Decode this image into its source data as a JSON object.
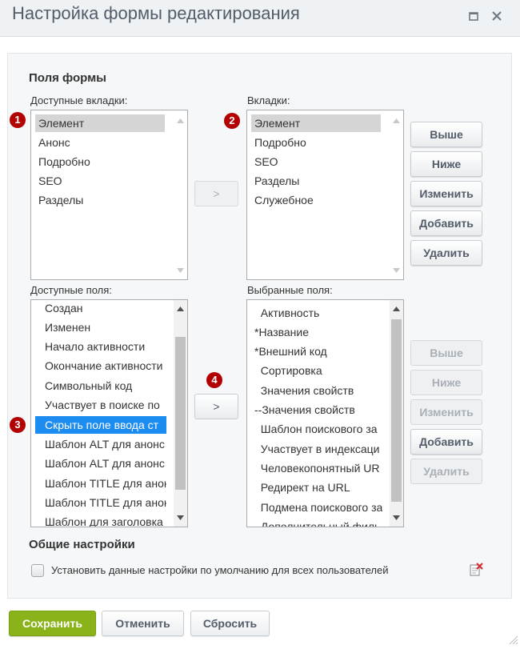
{
  "window": {
    "title": "Настройка формы редактирования"
  },
  "form_fields": {
    "section_title": "Поля формы",
    "available_tabs": {
      "label": "Доступные вкладки:",
      "items": [
        "Элемент",
        "Анонс",
        "Подробно",
        "SEO",
        "Разделы"
      ],
      "selected": "Элемент"
    },
    "tabs": {
      "label": "Вкладки:",
      "items": [
        "Элемент",
        "Подробно",
        "SEO",
        "Разделы",
        "Служебное"
      ],
      "selected": "Элемент"
    },
    "available_fields": {
      "label": "Доступные поля:",
      "items": [
        "Создан",
        "Изменен",
        "Начало активности",
        "Окончание активности",
        "Символьный код",
        "Участвует в поиске по",
        "Скрыть поле ввода ст",
        "Шаблон ALT для анонс",
        "Шаблон ALT для анонс",
        "Шаблон TITLE для анон",
        "Шаблон TITLE для анон",
        "Шаблон для заголовка"
      ],
      "selected": "Скрыть поле ввода ст"
    },
    "selected_fields": {
      "label": "Выбранные поля:",
      "items": [
        "  Активность",
        "*Название",
        "*Внешний код",
        "  Сортировка",
        "  Значения свойств",
        "--Значения свойств",
        "  Шаблон поискового за",
        "  Участвует в индексаци",
        "  Человекопонятный UR",
        "  Редирект на URL",
        "  Подмена поискового за",
        "  Дополнительный филь"
      ]
    },
    "move_tab_button": ">",
    "move_field_button": ">",
    "tab_buttons": {
      "up": "Выше",
      "down": "Ниже",
      "edit": "Изменить",
      "add": "Добавить",
      "delete": "Удалить"
    },
    "field_buttons": {
      "up": "Выше",
      "down": "Ниже",
      "edit": "Изменить",
      "add": "Добавить",
      "delete": "Удалить"
    },
    "badges": [
      "1",
      "2",
      "3",
      "4"
    ]
  },
  "general": {
    "section_title": "Общие настройки",
    "default_checkbox_label": "Установить данные настройки по умолчанию для всех пользователей",
    "default_checkbox_checked": false
  },
  "footer": {
    "save": "Сохранить",
    "cancel": "Отменить",
    "reset": "Сбросить"
  },
  "colors": {
    "badge": "#b30000",
    "selection_blue": "#1c8cf0",
    "save_button": "#89b318"
  },
  "icons": {
    "maximize": "maximize-icon",
    "close": "close-icon",
    "reset_defaults": "delete-settings-icon",
    "resize": "resize-grip-icon"
  }
}
